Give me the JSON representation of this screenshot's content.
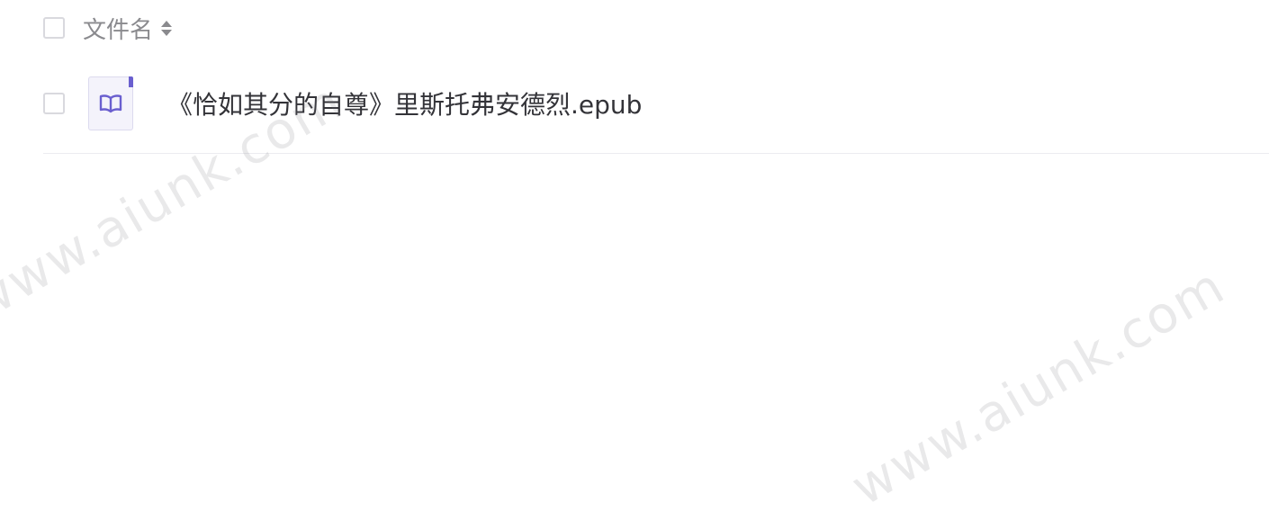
{
  "file_list": {
    "header": {
      "column_title": "文件名"
    },
    "files": [
      {
        "name": "《恰如其分的自尊》里斯托弗安德烈.epub",
        "icon": "book-icon"
      }
    ]
  },
  "watermarks": [
    "www.aiunk.com",
    "www.aiunk.com"
  ],
  "colors": {
    "accent": "#6a5fcf",
    "text_primary": "#333338",
    "text_secondary": "#8a8a8e",
    "divider": "#ececf0"
  }
}
